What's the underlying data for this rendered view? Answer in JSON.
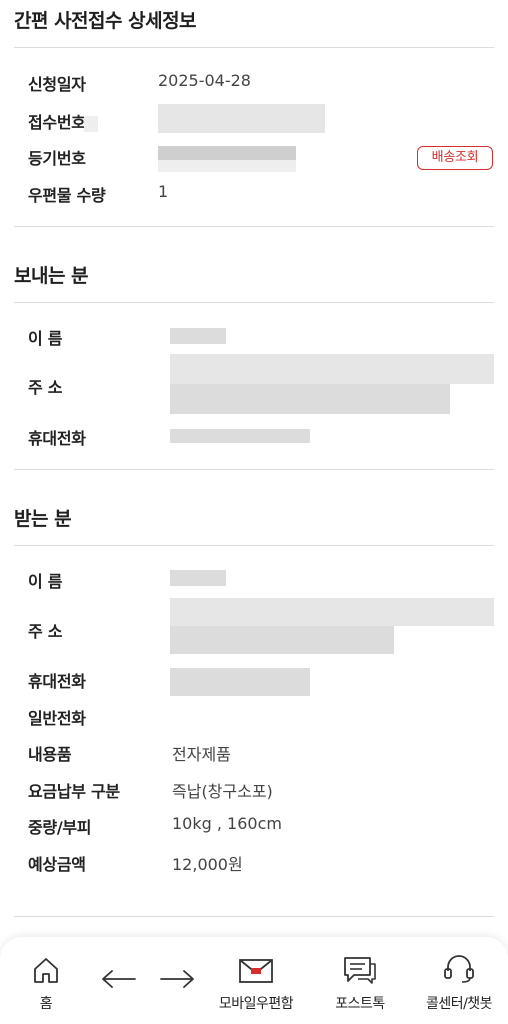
{
  "header": {
    "title": "간편 사전접수 상세정보"
  },
  "application": {
    "date_label": "신청일자",
    "date_value": "2025-04-28",
    "receipt_no_label": "접수번호",
    "tracking_no_label": "등기번호",
    "track_button_label": "배송조회",
    "quantity_label": "우편물 수량",
    "quantity_value": "1"
  },
  "sender": {
    "title": "보내는 분",
    "name_label": "이 름",
    "address_label": "주 소",
    "mobile_label": "휴대전화"
  },
  "recipient": {
    "title": "받는 분",
    "name_label": "이 름",
    "address_label": "주 소",
    "mobile_label": "휴대전화",
    "phone_label": "일반전화",
    "contents_label": "내용품",
    "contents_value": "전자제품",
    "payment_label": "요금납부 구분",
    "payment_value": "즉납(창구소포)",
    "weight_label": "중량/부피",
    "weight_value": "10kg , 160cm",
    "fee_label": "예상금액",
    "fee_value": "12,000원"
  },
  "bottom_nav": {
    "home_label": "홈",
    "mobile_post_label": "모바일우편함",
    "posttalk_label": "포스트톡",
    "callcenter_label": "콜센터/챗봇"
  },
  "colors": {
    "accent": "#d32f2f",
    "text": "#222222",
    "divider": "#dcdcdc"
  }
}
